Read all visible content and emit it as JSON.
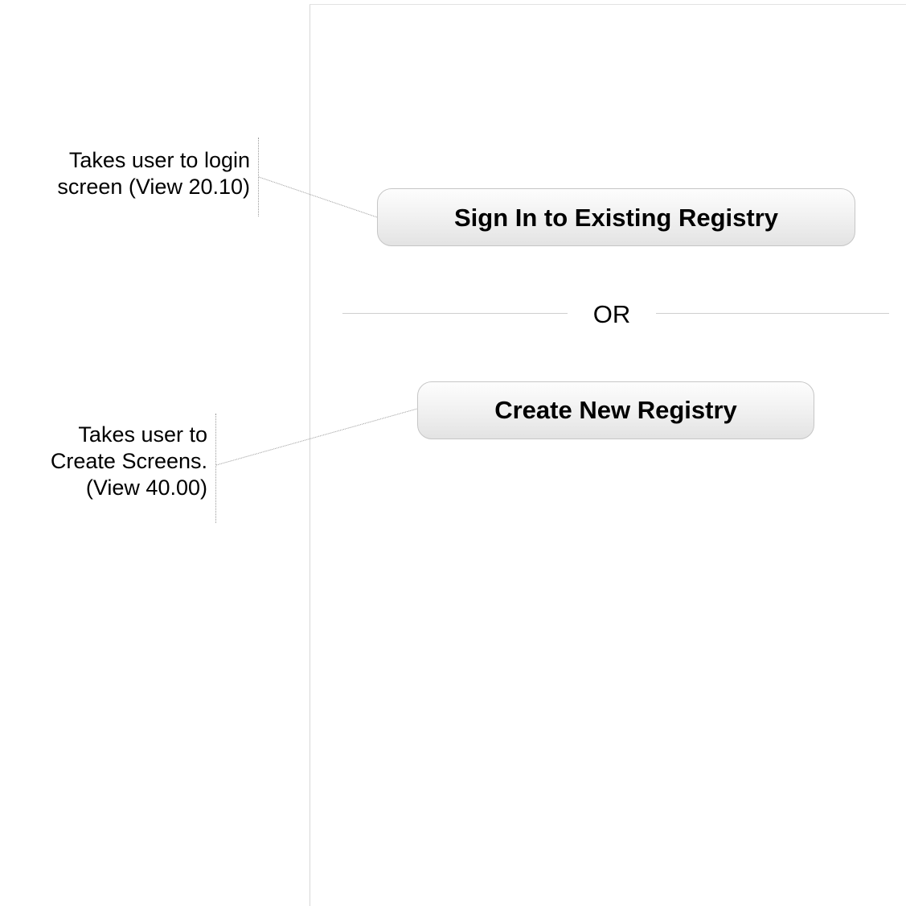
{
  "main": {
    "signin_label": "Sign In to Existing Registry",
    "divider_label": "OR",
    "create_label": "Create New Registry"
  },
  "annotations": [
    {
      "lines": [
        "Takes user to login",
        "screen (View 20.10)"
      ]
    },
    {
      "lines": [
        "Takes user to",
        "Create Screens.",
        "(View 40.00)"
      ]
    }
  ],
  "colors": {
    "button_border": "#c6c6c6",
    "divider": "#cfcfcf",
    "panel_border": "#d6d6d6",
    "connector": "#9a9a9a"
  }
}
